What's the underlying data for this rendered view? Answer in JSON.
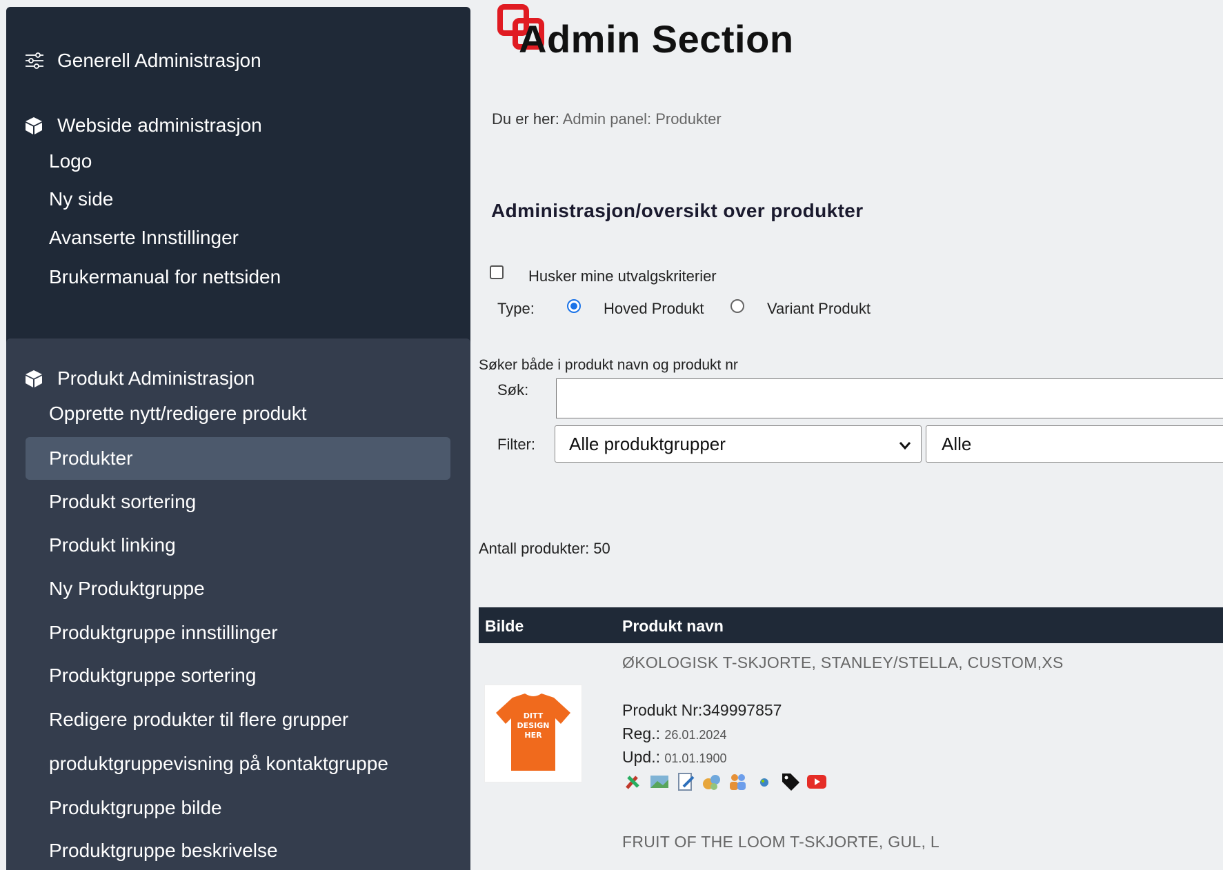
{
  "sidebar": {
    "section1": {
      "header": "Generell Administrasjon",
      "icon": "sliders-icon"
    },
    "section2": {
      "header": "Webside administrasjon",
      "icon": "box-icon",
      "items": [
        "Logo",
        "Ny side",
        "Avanserte Innstillinger",
        "Brukermanual for nettsiden"
      ]
    },
    "section3": {
      "header": "Produkt Administrasjon",
      "icon": "box-icon",
      "items": [
        "Opprette nytt/redigere produkt",
        "Produkter",
        "Produkt sortering",
        "Produkt linking",
        "Ny Produktgruppe",
        "Produktgruppe innstillinger",
        "Produktgruppe sortering",
        "Redigere produkter til flere grupper",
        "produktgruppevisning på kontaktgruppe",
        "Produktgruppe bilde",
        "Produktgruppe beskrivelse"
      ],
      "active_item": "Produkter"
    }
  },
  "header": {
    "title": "Admin Section",
    "logo_color": "#e01b22"
  },
  "breadcrumb": {
    "prefix": "Du er her:",
    "path": "Admin panel: Produkter"
  },
  "main": {
    "heading": "Administrasjon/oversikt over produkter",
    "remember_checkbox_label": "Husker mine utvalgskriterier",
    "remember_checked": false,
    "type_label": "Type:",
    "type_options": [
      "Hoved Produkt",
      "Variant Produkt"
    ],
    "type_selected": "Hoved Produkt",
    "search_hint": "Søker både i produkt navn og produkt nr",
    "search_label": "Søk:",
    "search_value": "",
    "filter_label": "Filter:",
    "filter_group_value": "Alle produktgrupper",
    "filter_second_value": "Alle",
    "count_text": "Antall produkter: 50"
  },
  "table": {
    "columns": [
      "Bilde",
      "Produkt navn"
    ],
    "rows": [
      {
        "name": "ØKOLOGISK T-SKJORTE, STANLEY/STELLA, CUSTOM,XS",
        "image_text": "DITT DESIGN HER",
        "product_nr_label": "Produkt Nr:",
        "product_nr": "349997857",
        "reg_label": "Reg.:",
        "reg_date": "26.01.2024",
        "upd_label": "Upd.:",
        "upd_date": "01.01.1900",
        "action_icons": [
          "tools-icon",
          "image-icon",
          "edit-icon",
          "group-icon",
          "users-icon",
          "globe-icon",
          "tag-icon",
          "youtube-icon"
        ]
      },
      {
        "name": "FRUIT OF THE LOOM T-SKJORTE, GUL, L"
      }
    ]
  },
  "colors": {
    "sidebar_bg": "#1f2937",
    "sidebar_section_bg": "#343d4d",
    "active_item_bg": "#4c596c",
    "table_header_bg": "#1f2937",
    "radio_accent": "#1a73e8",
    "shirt": "#f06a1d"
  }
}
